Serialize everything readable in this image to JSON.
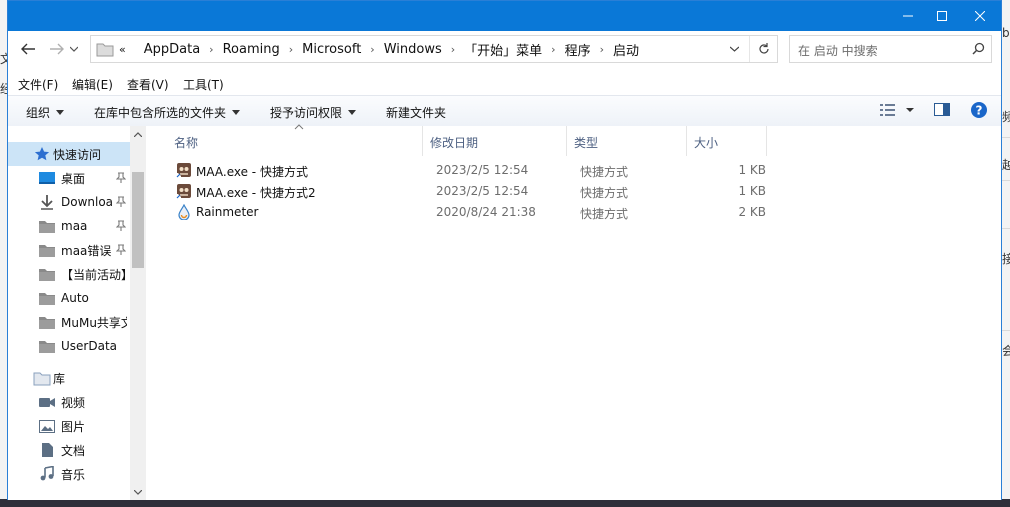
{
  "background_app": {
    "left_glyphs": [
      "文",
      "经"
    ],
    "right_glyphs": [
      "b",
      "频",
      "越",
      "接",
      "会"
    ]
  },
  "window": {
    "nav": {
      "back": "back-arrow",
      "forward": "forward-arrow",
      "recent": "chevron-down",
      "up": "up-arrow"
    },
    "breadcrumb": [
      "«",
      "AppData",
      "Roaming",
      "Microsoft",
      "Windows",
      "「开始」菜单",
      "程序",
      "启动"
    ],
    "search_placeholder": "在 启动 中搜索",
    "menu": [
      "文件(F)",
      "编辑(E)",
      "查看(V)",
      "工具(T)"
    ],
    "toolbar": {
      "organize": "组织",
      "include_in_library": "在库中包含所选的文件夹",
      "share": "授予访问权限",
      "new_folder": "新建文件夹"
    },
    "sidebar": {
      "quick_access": "快速访问",
      "items": [
        {
          "label": "桌面",
          "pinned": true
        },
        {
          "label": "Downloa",
          "pinned": true
        },
        {
          "label": "maa",
          "pinned": true
        },
        {
          "label": "maa错误",
          "pinned": true
        },
        {
          "label": "【当前活动】",
          "pinned": false
        },
        {
          "label": "Auto",
          "pinned": false
        },
        {
          "label": "MuMu共享文",
          "pinned": false
        },
        {
          "label": "UserData",
          "pinned": false
        }
      ],
      "library": "库",
      "library_items": [
        "视频",
        "图片",
        "文档",
        "音乐"
      ]
    },
    "columns": {
      "name": "名称",
      "modified": "修改日期",
      "type": "类型",
      "size": "大小"
    },
    "files": [
      {
        "name": "MAA.exe - 快捷方式",
        "modified": "2023/2/5 12:54",
        "type": "快捷方式",
        "size": "1 KB",
        "icon": "maa-icon"
      },
      {
        "name": "MAA.exe - 快捷方式2",
        "modified": "2023/2/5 12:54",
        "type": "快捷方式",
        "size": "1 KB",
        "icon": "maa-icon"
      },
      {
        "name": "Rainmeter",
        "modified": "2020/8/24 21:38",
        "type": "快捷方式",
        "size": "2 KB",
        "icon": "rainmeter-icon"
      }
    ]
  },
  "colors": {
    "titlebar": "#0a78d7",
    "selection": "#cce4f7",
    "folder": "#e8b34a",
    "help": "#1a66c9"
  }
}
